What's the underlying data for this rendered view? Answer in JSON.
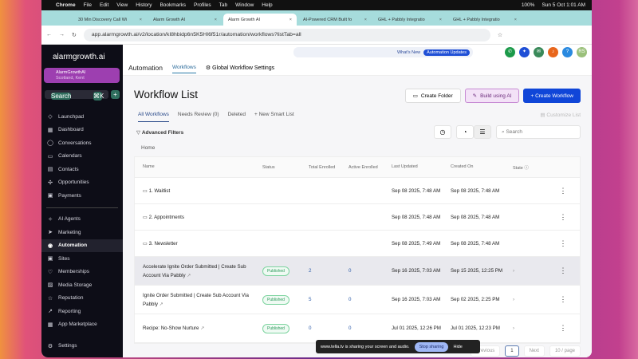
{
  "menubar": {
    "app": "Chrome",
    "items": [
      "File",
      "Edit",
      "View",
      "History",
      "Bookmarks",
      "Profiles",
      "Tab",
      "Window",
      "Help"
    ],
    "battery": "100%",
    "clock": "Sun 5 Oct  1:01 AM"
  },
  "tabs": [
    "30 Min Discovery Call Wi",
    "Alarm Growth AI",
    "Alarm Growth AI",
    "AI-Powered CRM Built fo",
    "GHL + Pabbly Integratio",
    "GHL + Pabbly Integratio"
  ],
  "url": "app.alarmgrowth.ai/v2/location/kI8hbidp6n5K5HI6f51r/automation/workflows?listTab=all",
  "sidebar": {
    "logo": "alarmgrowth.ai",
    "account": "AlarmGrowthAI",
    "account_sub": "Scotland, Kent",
    "search": "Search",
    "shortcut": "⌘K",
    "items": [
      {
        "icon": "◇",
        "label": "Launchpad"
      },
      {
        "icon": "▦",
        "label": "Dashboard"
      },
      {
        "icon": "◯",
        "label": "Conversations"
      },
      {
        "icon": "▭",
        "label": "Calendars"
      },
      {
        "icon": "▤",
        "label": "Contacts"
      },
      {
        "icon": "✣",
        "label": "Opportunities"
      },
      {
        "icon": "▣",
        "label": "Payments"
      }
    ],
    "items2": [
      {
        "icon": "✧",
        "label": "AI Agents"
      },
      {
        "icon": "➤",
        "label": "Marketing"
      },
      {
        "icon": "◉",
        "label": "Automation"
      },
      {
        "icon": "▣",
        "label": "Sites"
      },
      {
        "icon": "♡",
        "label": "Memberships"
      },
      {
        "icon": "▨",
        "label": "Media Storage"
      },
      {
        "icon": "☆",
        "label": "Reputation"
      },
      {
        "icon": "↗",
        "label": "Reporting"
      },
      {
        "icon": "▦",
        "label": "App Marketplace"
      }
    ],
    "settings": "Settings"
  },
  "header": {
    "whats_new": "What's New",
    "updates": "Automation Updates",
    "avatar": "RS"
  },
  "subnav": {
    "title": "Automation",
    "workflows": "Workflows",
    "global": "Global Workflow Settings"
  },
  "page": {
    "title": "Workflow List",
    "create_folder": "Create Folder",
    "build_ai": "Build using AI",
    "create_workflow": "+ Create Workflow",
    "tabs": [
      "All Workflows",
      "Needs Review (0)",
      "Deleted",
      "+ New Smart List"
    ],
    "customize": "Customize List",
    "filters": "Advanced Filters",
    "search": "Search",
    "home": "Home"
  },
  "table": {
    "headers": [
      "Name",
      "Status",
      "Total Enrolled",
      "Active Enrolled",
      "Last Updated",
      "Created On",
      "State ⓘ"
    ],
    "rows": [
      {
        "name": "1. Waitlist",
        "folder": true,
        "status": "",
        "total": "",
        "active": "",
        "updated": "Sep 08 2025, 7:48 AM",
        "created": "Sep 08 2025, 7:48 AM"
      },
      {
        "name": "2. Appointments",
        "folder": true,
        "status": "",
        "total": "",
        "active": "",
        "updated": "Sep 08 2025, 7:48 AM",
        "created": "Sep 08 2025, 7:48 AM"
      },
      {
        "name": "3. Newsletter",
        "folder": true,
        "status": "",
        "total": "",
        "active": "",
        "updated": "Sep 08 2025, 7:49 AM",
        "created": "Sep 08 2025, 7:48 AM"
      },
      {
        "name": "Accelerate Ignite Order Submitted | Create Sub Account Via Pabbly",
        "status": "Published",
        "total": "2",
        "active": "0",
        "updated": "Sep 16 2025, 7:03 AM",
        "created": "Sep 15 2025, 12:25 PM"
      },
      {
        "name": "Ignite Order Submitted | Create Sub Account Via Pabbly",
        "status": "Published",
        "total": "5",
        "active": "0",
        "updated": "Sep 16 2025, 7:03 AM",
        "created": "Sep 02 2025, 2:25 PM"
      },
      {
        "name": "Recipe: No-Show Nurture",
        "status": "Published",
        "total": "0",
        "active": "0",
        "updated": "Jul 01 2025, 12:26 PM",
        "created": "Jul 01 2025, 12:23 PM"
      }
    ]
  },
  "pagination": {
    "previous": "Previous",
    "page": "1",
    "next": "Next",
    "size": "10 / page"
  },
  "share": {
    "text": "www.tella.tv is sharing your screen and audio.",
    "stop": "Stop sharing",
    "hide": "Hide"
  }
}
